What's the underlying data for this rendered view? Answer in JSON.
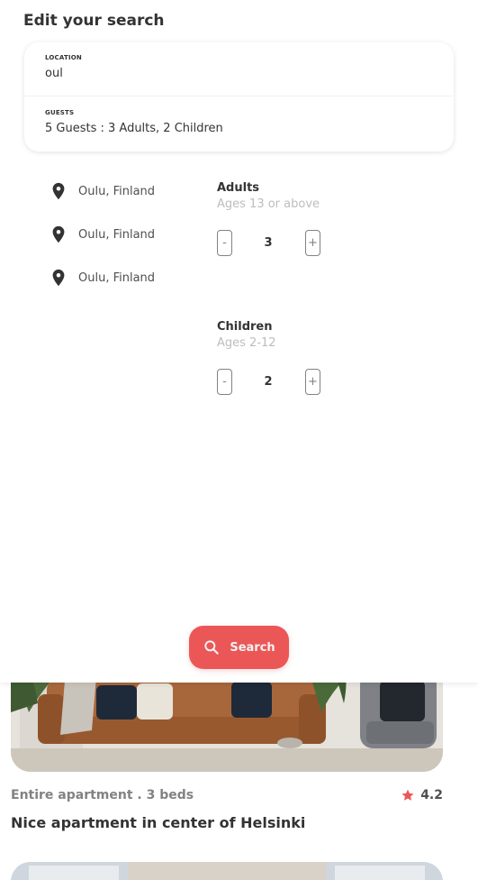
{
  "edit_panel": {
    "title": "Edit your search",
    "location": {
      "label": "LOCATION",
      "value": "oul"
    },
    "guests": {
      "label": "GUESTS",
      "summary": "5 Guests : 3 Adults, 2 Children"
    }
  },
  "suggestions": [
    {
      "label": "Oulu, Finland",
      "icon": "map-pin-icon"
    },
    {
      "label": "Oulu, Finland",
      "icon": "map-pin-icon"
    },
    {
      "label": "Oulu, Finland",
      "icon": "map-pin-icon"
    }
  ],
  "adults": {
    "title": "Adults",
    "subtitle": "Ages 13 or above",
    "count": "3",
    "minus": "-",
    "plus": "+"
  },
  "children": {
    "title": "Children",
    "subtitle": "Ages 2-12",
    "count": "2",
    "minus": "-",
    "plus": "+"
  },
  "search_button": {
    "label": "Search",
    "icon": "search-icon"
  },
  "listing": {
    "type": "Entire apartment . 3 beds",
    "rating": "4.2",
    "title": "Nice apartment in center of Helsinki"
  },
  "colors": {
    "accent": "#EB5757",
    "text_primary": "#333333",
    "text_secondary": "#828282",
    "text_muted": "#BDBDBD"
  }
}
